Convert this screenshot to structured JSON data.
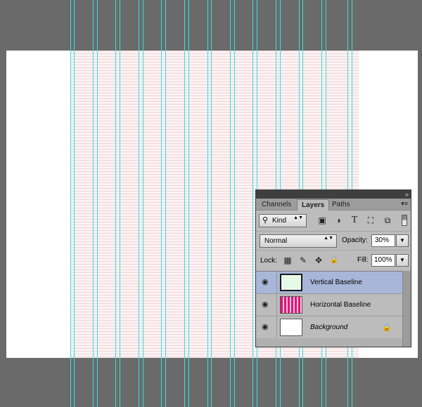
{
  "canvas": {
    "background": "#ffffff",
    "guide_color": "#34e0e0"
  },
  "panel": {
    "collapse_glyph": "»",
    "menu_glyph": "▾≡",
    "tabs": [
      "Channels",
      "Layers",
      "Paths"
    ],
    "active_tab": "Layers",
    "filter": {
      "kind_label": "Kind",
      "search_glyph": "⚲",
      "dropdown_glyph": "▲▼",
      "icons": [
        {
          "name": "pixel-layer-filter-icon",
          "glyph": "▣"
        },
        {
          "name": "adjustment-layer-filter-icon",
          "glyph": "◑"
        },
        {
          "name": "type-layer-filter-icon",
          "glyph": "T"
        },
        {
          "name": "shape-layer-filter-icon",
          "glyph": "⛶"
        },
        {
          "name": "smart-object-filter-icon",
          "glyph": "⧉"
        }
      ]
    },
    "blend_mode": "Normal",
    "opacity_label": "Opacity:",
    "opacity_value": "30%",
    "lock_label": "Lock:",
    "lock_icons": [
      {
        "name": "lock-transparent-pixels-icon",
        "glyph": "▦"
      },
      {
        "name": "lock-image-pixels-icon",
        "glyph": "✎"
      },
      {
        "name": "lock-position-icon",
        "glyph": "✥"
      },
      {
        "name": "lock-all-icon",
        "glyph": "🔒"
      }
    ],
    "fill_label": "Fill:",
    "fill_value": "100%",
    "dropdown_arrow": "▼",
    "eye_glyph": "◉",
    "layers": [
      {
        "name": "Vertical Baseline",
        "selected": true
      },
      {
        "name": "Horizontal Baseline",
        "selected": false
      },
      {
        "name": "Background",
        "selected": false,
        "italic": true,
        "locked": true
      }
    ],
    "background_lock_glyph": "🔒",
    "selection_color": "#a8b6d8"
  }
}
